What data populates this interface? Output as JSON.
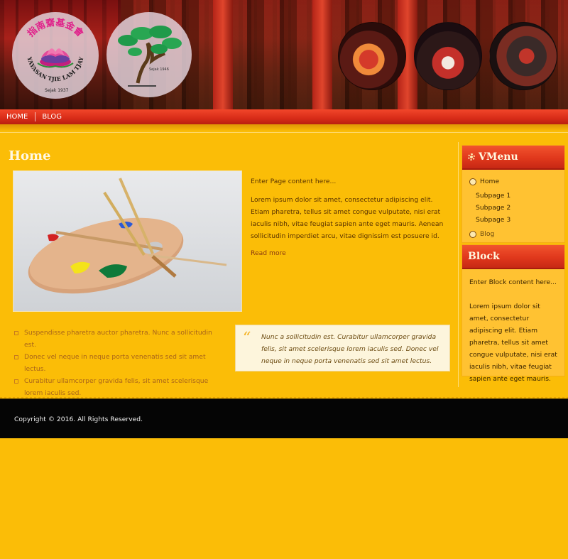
{
  "header": {
    "logo1_text": "YAYASAN TJIE LAM TJAY",
    "logo1_since": "Sejak 1937",
    "logo1_chinese": "指南齋基金會",
    "logo2_since": "Sejak 1946"
  },
  "nav": {
    "items": [
      {
        "label": "HOME"
      },
      {
        "label": "BLOG"
      }
    ]
  },
  "main": {
    "title": "Home",
    "intro": "Enter Page content here...",
    "lorem": "Lorem ipsum dolor sit amet, consectetur adipiscing elit. Etiam pharetra, tellus sit amet congue vulputate, nisi erat iaculis nibh, vitae feugiat sapien ante eget mauris. Aenean sollicitudin imperdiet arcu, vitae dignissim est posuere id.",
    "read_more": "Read more",
    "bullets": [
      "Suspendisse pharetra auctor pharetra. Nunc a sollicitudin est.",
      "Donec vel neque in neque porta venenatis sed sit amet lectus.",
      "Curabitur ullamcorper gravida felis, sit amet scelerisque lorem iaculis sed."
    ],
    "quote": "Nunc a sollicitudin est. Curabitur ullamcorper gravida felis, sit amet scelerisque lorem iaculis sed. Donec vel neque in neque porta venenatis sed sit amet lectus.",
    "quote_mark": "“"
  },
  "sidebar": {
    "vmenu_title": "VMenu",
    "vmenu_items": [
      {
        "label": "Home"
      },
      {
        "label": "Subpage 1"
      },
      {
        "label": "Subpage 2"
      },
      {
        "label": "Subpage 3"
      },
      {
        "label": "Blog"
      }
    ],
    "block_title": "Block",
    "block_intro": "Enter Block content here...",
    "block_lorem": "Lorem ipsum dolor sit amet, consectetur adipiscing elit. Etiam pharetra, tellus sit amet congue vulputate, nisi erat iaculis nibh, vitae feugiat sapien ante eget mauris."
  },
  "footer": {
    "copyright": "Copyright © 2016. All Rights Reserved."
  },
  "colors": {
    "page_bg": "#fbbd07",
    "nav_red": "#d82c18",
    "footer_bg": "#050505"
  }
}
